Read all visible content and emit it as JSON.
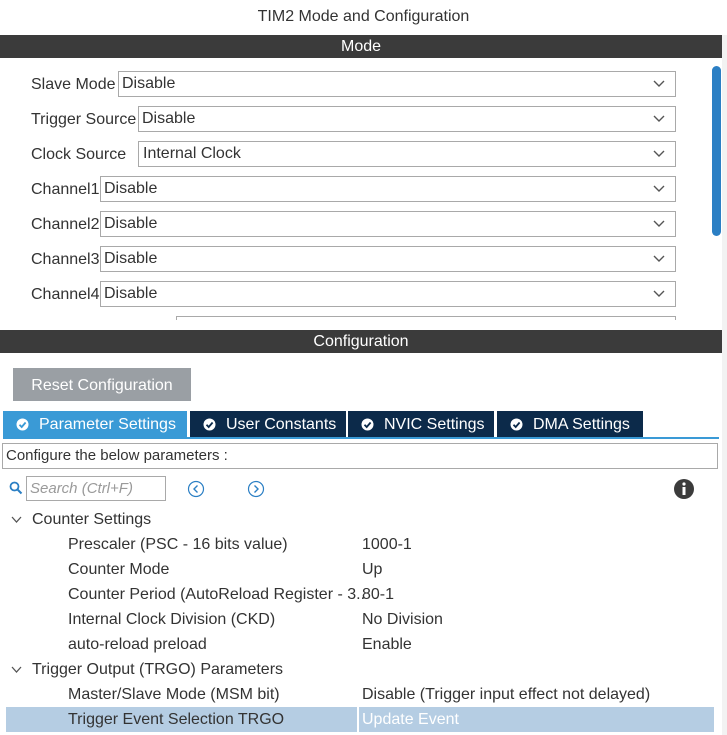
{
  "window": {
    "title": "TIM2 Mode and Configuration"
  },
  "mode": {
    "header": "Mode",
    "rows": [
      {
        "label": "Slave Mode",
        "value": "Disable"
      },
      {
        "label": "Trigger Source",
        "value": "Disable"
      },
      {
        "label": "Clock Source",
        "value": "Internal Clock"
      },
      {
        "label": "Channel1",
        "value": "Disable"
      },
      {
        "label": "Channel2",
        "value": "Disable"
      },
      {
        "label": "Channel3",
        "value": "Disable"
      },
      {
        "label": "Channel4",
        "value": "Disable"
      }
    ]
  },
  "configuration": {
    "header": "Configuration",
    "reset_label": "Reset Configuration",
    "tabs": [
      {
        "label": "Parameter Settings",
        "active": true
      },
      {
        "label": "User Constants",
        "active": false
      },
      {
        "label": "NVIC Settings",
        "active": false
      },
      {
        "label": "DMA Settings",
        "active": false
      }
    ],
    "description": "Configure the below parameters :",
    "search": {
      "placeholder": "Search (Ctrl+F)",
      "value": ""
    },
    "groups": [
      {
        "name": "Counter Settings",
        "params": [
          {
            "name": "Prescaler (PSC - 16 bits value)",
            "value": "1000-1"
          },
          {
            "name": "Counter Mode",
            "value": "Up"
          },
          {
            "name": "Counter Period (AutoReload Register - 3..",
            "value": "80-1"
          },
          {
            "name": "Internal Clock Division (CKD)",
            "value": "No Division"
          },
          {
            "name": "auto-reload preload",
            "value": "Enable"
          }
        ]
      },
      {
        "name": "Trigger Output (TRGO) Parameters",
        "params": [
          {
            "name": "Master/Slave Mode (MSM bit)",
            "value": "Disable (Trigger input effect not delayed)"
          },
          {
            "name": "Trigger Event Selection TRGO",
            "value": "Update Event"
          }
        ]
      }
    ]
  },
  "colors": {
    "header_bg": "#3b3b3b",
    "tab_active": "#3a9ad6",
    "tab_inactive": "#0c2a4a",
    "selected_row": "#b5cde3",
    "scrollbar": "#2b7fc4",
    "reset_button": "#9a9fa4"
  },
  "icons": {
    "select_arrow": "chevron-down-icon",
    "tab_check": "check-circle-icon",
    "search": "search-icon",
    "prev": "chevron-left-circle-icon",
    "next": "chevron-right-circle-icon",
    "info": "info-icon",
    "group_toggle": "caret-down-icon"
  }
}
